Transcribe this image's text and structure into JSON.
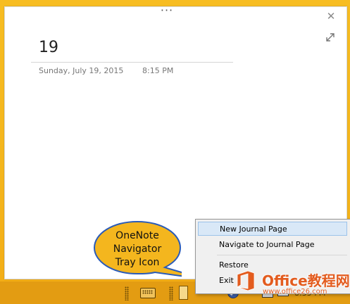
{
  "note": {
    "title": "19",
    "date": "Sunday, July 19, 2015",
    "time": "8:15 PM",
    "dots": "···",
    "close": "✕"
  },
  "context_menu": {
    "items": [
      {
        "label": "New Journal Page",
        "active": true
      },
      {
        "label": "Navigate to Journal Page",
        "active": false
      },
      {
        "label": "Restore",
        "active": false
      },
      {
        "label": "Exit",
        "active": false
      }
    ]
  },
  "callout": {
    "lines": [
      "OneNote",
      "Navigator",
      "Tray Icon"
    ]
  },
  "taskbar": {
    "clock": "8:35 PM",
    "tray_arrow": "▲"
  },
  "watermark": {
    "brand": "Office教程网",
    "url": "www.office26.com"
  },
  "colors": {
    "desktop": "#f5b91e",
    "taskbar": "#e39c12",
    "callout_fill": "#f4b61e",
    "callout_stroke": "#2a5bb8",
    "menu_highlight": "#d9e8f7",
    "watermark": "#e35c1f"
  }
}
